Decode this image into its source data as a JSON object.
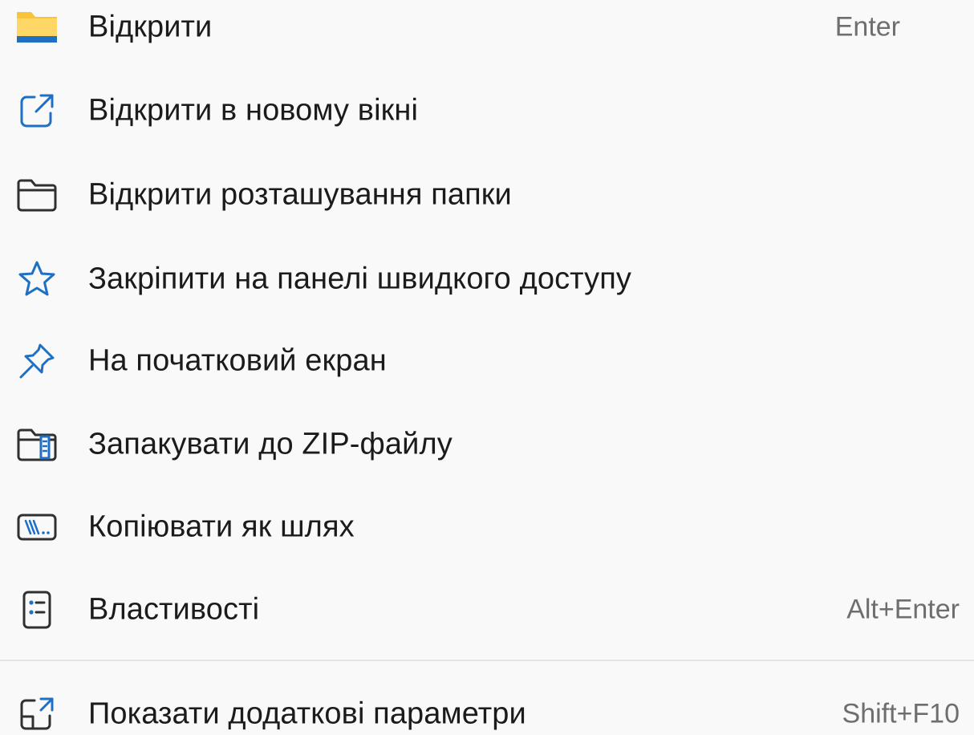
{
  "menu": {
    "items": [
      {
        "label": "Відкрити",
        "shortcut": "Enter",
        "icon": "folder-yellow-icon"
      },
      {
        "label": "Відкрити в новому вікні",
        "shortcut": "",
        "icon": "open-new-window-icon"
      },
      {
        "label": "Відкрити розташування папки",
        "shortcut": "",
        "icon": "folder-outline-icon"
      },
      {
        "label": "Закріпити на панелі швидкого доступу",
        "shortcut": "",
        "icon": "star-icon"
      },
      {
        "label": "На початковий екран",
        "shortcut": "",
        "icon": "pin-icon"
      },
      {
        "label": "Запакувати до ZIP-файлу",
        "shortcut": "",
        "icon": "zip-folder-icon"
      },
      {
        "label": "Копіювати як шлях",
        "shortcut": "",
        "icon": "copy-path-icon"
      },
      {
        "label": "Властивості",
        "shortcut": "Alt+Enter",
        "icon": "properties-icon"
      },
      {
        "label": "Показати додаткові параметри",
        "shortcut": "Shift+F10",
        "icon": "more-options-icon"
      }
    ]
  },
  "colors": {
    "background": "#f9f9f9",
    "text": "#1b1b1b",
    "shortcut_text": "#6e6e6e",
    "accent_blue": "#0f6cbd",
    "folder_yellow": "#f8c53a",
    "separator": "#e3e3e3"
  }
}
